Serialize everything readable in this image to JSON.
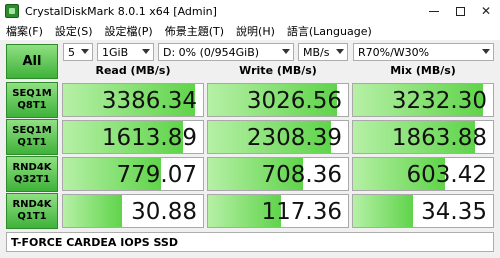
{
  "window": {
    "title": "CrystalDiskMark 8.0.1 x64 [Admin]"
  },
  "menu": [
    "檔案(F)",
    "設定(S)",
    "設定檔(P)",
    "佈景主題(T)",
    "說明(H)",
    "語言(Language)"
  ],
  "controls": {
    "all_label": "All",
    "count": "5",
    "size": "1GiB",
    "drive": "D: 0% (0/954GiB)",
    "unit": "MB/s",
    "mix": "R70%/W30%"
  },
  "headers": {
    "read": "Read (MB/s)",
    "write": "Write (MB/s)",
    "mix": "Mix (MB/s)"
  },
  "rows": [
    {
      "line1": "SEQ1M",
      "line2": "Q8T1",
      "read": "3386.34",
      "write": "3026.56",
      "mix": "3232.30",
      "read_level": 0.94,
      "write_level": 0.92,
      "mix_level": 0.93
    },
    {
      "line1": "SEQ1M",
      "line2": "Q1T1",
      "read": "1613.89",
      "write": "2308.39",
      "mix": "1863.88",
      "read_level": 0.86,
      "write_level": 0.88,
      "mix_level": 0.87
    },
    {
      "line1": "RND4K",
      "line2": "Q32T1",
      "read": "779.07",
      "write": "708.36",
      "mix": "603.42",
      "read_level": 0.7,
      "write_level": 0.68,
      "mix_level": 0.66
    },
    {
      "line1": "RND4K",
      "line2": "Q1T1",
      "read": "30.88",
      "write": "117.36",
      "mix": "34.35",
      "read_level": 0.42,
      "write_level": 0.52,
      "mix_level": 0.43
    }
  ],
  "comment": "T-FORCE CARDEA IOPS SSD",
  "colors": {
    "accent": "#3fb23a",
    "bar_light": "#b6f0a6",
    "bar_dark": "#5fd44a"
  }
}
